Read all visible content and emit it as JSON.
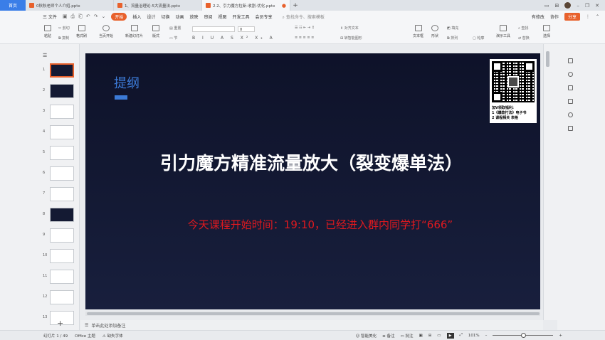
{
  "tabs": {
    "home": "首页",
    "docs": [
      {
        "title": "0秋秋老师个人介绍.pptx",
        "active": false
      },
      {
        "title": "1、流量治理论-5大流量法.pptx",
        "active": false
      },
      {
        "title": "2.2、引力魔方拉新-收割-优化.pptx",
        "active": true
      }
    ]
  },
  "menu": {
    "file": "三 文件",
    "items": [
      "开始",
      "插入",
      "设计",
      "切换",
      "动画",
      "放映",
      "审阅",
      "视图",
      "开发工具",
      "会员专享"
    ],
    "active": "开始",
    "search": "查找命令、搜索模板",
    "right": [
      "有修改",
      "协作",
      "分享"
    ]
  },
  "ribbon": {
    "paste": "粘贴",
    "cut": "剪切",
    "copy": "复制",
    "format_painter": "格式刷",
    "play_from_current": "当页开始",
    "new_slide": "新建幻灯片",
    "layout": "版式",
    "section": "节",
    "reset": "重置",
    "font_size": "0",
    "text_box": "文本框",
    "shape": "形状",
    "arrange": "排列",
    "outline": "轮廓",
    "fill": "填充",
    "presentation_tools": "演示工具",
    "find": "查找",
    "replace": "替换",
    "select": "选择",
    "smart_art": "转智能图形",
    "text_style": "对齐文本"
  },
  "slide": {
    "outline_title": "提纲",
    "main_title": "引力魔方精准流量放大（裂变爆单法）",
    "red_note": "今天课程开始时间：19:10，已经进入群内同学打“666”",
    "qr_caption_1": "加V领取福利:",
    "qr_caption_2": "1《爆款打法》电子书",
    "qr_caption_3": "2 课程相关 表格"
  },
  "thumbnails": [
    {
      "num": "1",
      "dark": true,
      "selected": true
    },
    {
      "num": "2",
      "dark": true,
      "selected": false
    },
    {
      "num": "3",
      "dark": false,
      "selected": false
    },
    {
      "num": "4",
      "dark": false,
      "selected": false
    },
    {
      "num": "5",
      "dark": false,
      "selected": false
    },
    {
      "num": "6",
      "dark": false,
      "selected": false
    },
    {
      "num": "7",
      "dark": false,
      "selected": false
    },
    {
      "num": "8",
      "dark": true,
      "selected": false
    },
    {
      "num": "9",
      "dark": false,
      "selected": false
    },
    {
      "num": "10",
      "dark": false,
      "selected": false
    },
    {
      "num": "11",
      "dark": false,
      "selected": false
    },
    {
      "num": "12",
      "dark": false,
      "selected": false
    },
    {
      "num": "13",
      "dark": false,
      "selected": false
    }
  ],
  "notes": {
    "placeholder": "单击此处添加备注"
  },
  "status": {
    "slide_count": "幻灯片 1 / 49",
    "theme": "Office 主题",
    "missing_font": "缺失字体",
    "smart_beautify": "智能美化",
    "notes": "备注",
    "comments": "批注",
    "zoom": "101%"
  }
}
